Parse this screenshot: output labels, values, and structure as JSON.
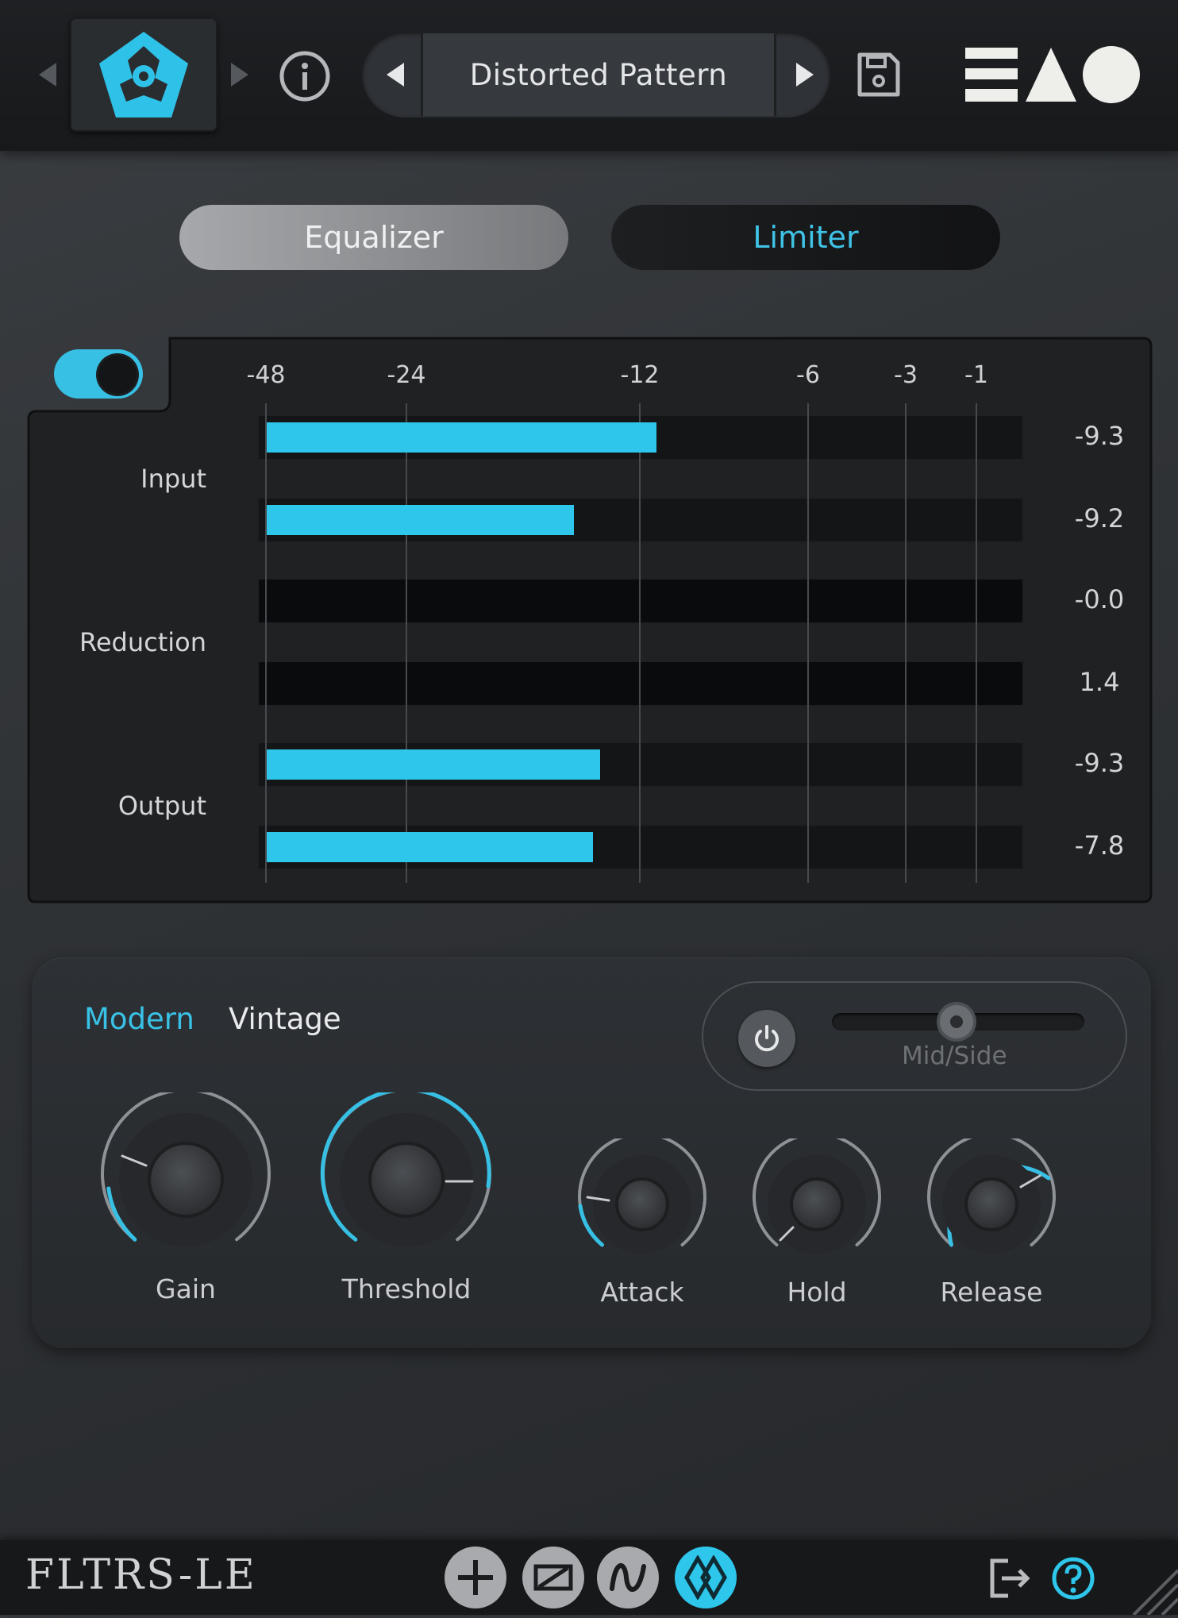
{
  "header": {
    "preset_name": "Distorted Pattern",
    "brand_logo_text": "ΞΛΟ"
  },
  "tabs": [
    {
      "label": "Equalizer",
      "active": true
    },
    {
      "label": "Limiter",
      "active": false
    }
  ],
  "meter": {
    "enabled": true,
    "scale_labels": [
      "-48",
      "-24",
      "-12",
      "-6",
      "-3",
      "-1"
    ],
    "row_labels": {
      "input": "Input",
      "reduction": "Reduction",
      "output": "Output"
    },
    "rows": [
      {
        "group": "Input",
        "value": "-9.3",
        "level": 0.52
      },
      {
        "group": "Input",
        "value": "-9.2",
        "level": 0.41
      },
      {
        "group": "Reduction",
        "value": "-0.0",
        "level": 0
      },
      {
        "group": "Reduction",
        "value": "1.4",
        "level": 0
      },
      {
        "group": "Output",
        "value": "-9.3",
        "level": 0.445
      },
      {
        "group": "Output",
        "value": "-7.8",
        "level": 0.435
      }
    ]
  },
  "controls": {
    "modes": [
      {
        "label": "Modern",
        "active": true
      },
      {
        "label": "Vintage",
        "active": false
      }
    ],
    "midside": {
      "label": "Mid/Side",
      "enabled": false,
      "position": 0.5
    },
    "knobs": [
      {
        "label": "Gain",
        "value": 0.15
      },
      {
        "label": "Threshold",
        "value": 0.75
      },
      {
        "label": "Attack",
        "value": 0.08
      },
      {
        "label": "Hold",
        "value": 0.0
      },
      {
        "label": "Release",
        "value": 0.65
      }
    ]
  },
  "footer": {
    "brand": "FLTRS-LE",
    "buttons": [
      {
        "icon": "plus-icon",
        "active": false
      },
      {
        "icon": "slash-box-icon",
        "active": false
      },
      {
        "icon": "wave-icon",
        "active": false
      },
      {
        "icon": "diamond-chain-icon",
        "active": true
      }
    ]
  },
  "colors": {
    "accent": "#2ec6ea",
    "background": "#2f3235",
    "panel": "#1f2123"
  }
}
